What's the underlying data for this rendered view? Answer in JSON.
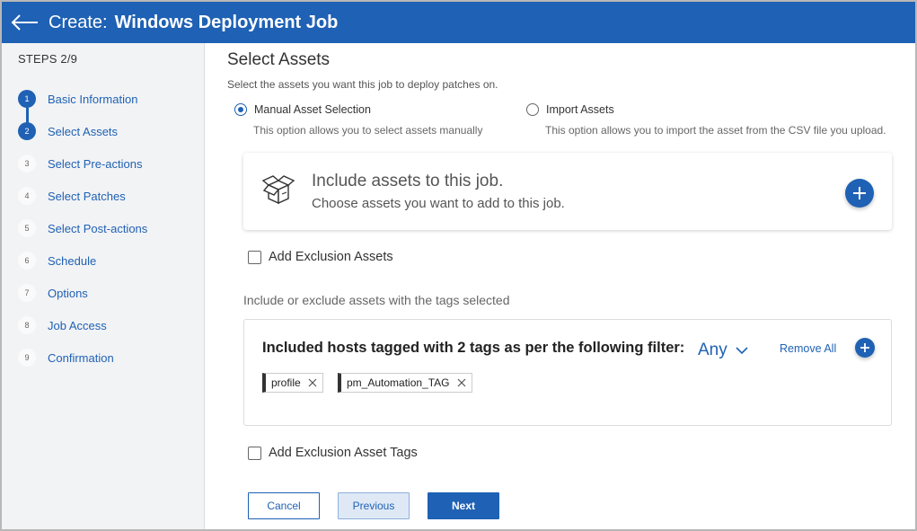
{
  "header": {
    "prefix": "Create:",
    "title": "Windows Deployment Job",
    "back_icon": "arrow-left-icon",
    "bg_color": "#1f61b4"
  },
  "sidebar": {
    "steps_count": "STEPS 2/9",
    "steps": [
      {
        "num": "1",
        "label": "Basic Information",
        "state": "done"
      },
      {
        "num": "2",
        "label": "Select Assets",
        "state": "current"
      },
      {
        "num": "3",
        "label": "Select Pre-actions",
        "state": "todo"
      },
      {
        "num": "4",
        "label": "Select Patches",
        "state": "todo"
      },
      {
        "num": "5",
        "label": "Select Post-actions",
        "state": "todo"
      },
      {
        "num": "6",
        "label": "Schedule",
        "state": "todo"
      },
      {
        "num": "7",
        "label": "Options",
        "state": "todo"
      },
      {
        "num": "8",
        "label": "Job Access",
        "state": "todo"
      },
      {
        "num": "9",
        "label": "Confirmation",
        "state": "todo"
      }
    ]
  },
  "main": {
    "title": "Select Assets",
    "subtitle": "Select the assets you want this job to deploy patches on.",
    "radio_options": [
      {
        "label": "Manual Asset Selection",
        "desc": "This option allows you to select assets manually",
        "checked": true
      },
      {
        "label": "Import Assets",
        "desc": "This option allows you to import the asset from the CSV file you upload.",
        "checked": false
      }
    ],
    "include_card": {
      "title": "Include assets to this job.",
      "subtitle": "Choose assets you want to add to this job.",
      "icon": "open-box-icon"
    },
    "exclusion_assets_label": "Add Exclusion Assets",
    "tags_hint": "Include or exclude assets with the tags selected",
    "tags_card": {
      "title": "Included hosts tagged with 2 tags as per the following filter:",
      "filter_value": "Any",
      "remove_all": "Remove All",
      "tags": [
        "profile",
        "pm_Automation_TAG"
      ]
    },
    "exclusion_tags_label": "Add Exclusion Asset Tags",
    "buttons": {
      "cancel": "Cancel",
      "previous": "Previous",
      "next": "Next"
    }
  }
}
